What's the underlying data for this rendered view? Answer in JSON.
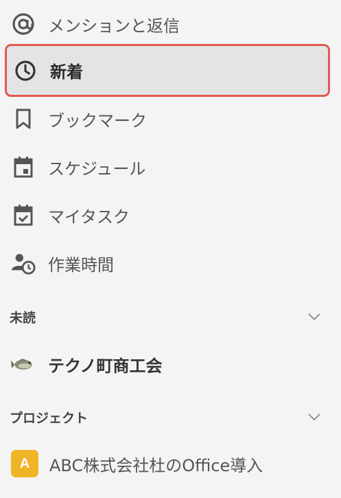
{
  "nav": {
    "mentions": "メンションと返信",
    "new": "新着",
    "bookmarks": "ブックマーク",
    "schedule": "スケジュール",
    "my_tasks": "マイタスク",
    "work_hours": "作業時間"
  },
  "sections": {
    "unread": {
      "title": "未読",
      "channels": [
        {
          "name": "テクノ町商工会",
          "icon": "fish-icon"
        }
      ]
    },
    "projects": {
      "title": "プロジェクト",
      "items": [
        {
          "badge": "A",
          "name": "ABC株式会社杜のOffice導入",
          "badge_color": "#f0b429"
        }
      ]
    }
  },
  "colors": {
    "active_border": "#e05a4e",
    "active_background": "#e4e4e4",
    "icon": "#555555"
  }
}
